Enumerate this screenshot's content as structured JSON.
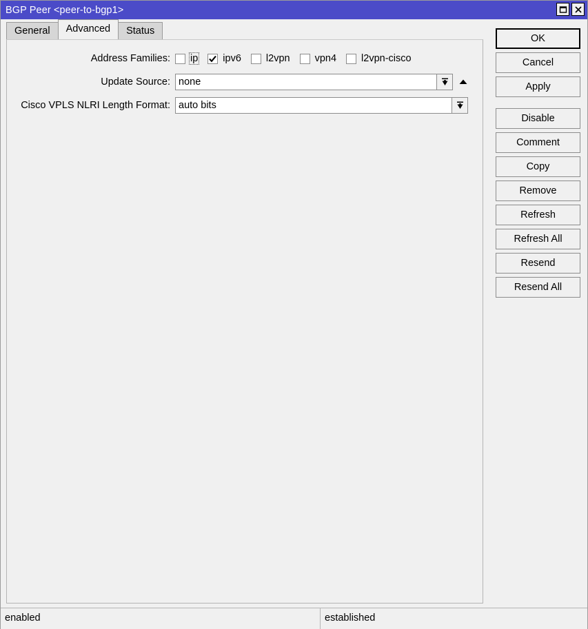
{
  "window": {
    "title": "BGP Peer <peer-to-bgp1>",
    "maximize_icon": "maximize-icon",
    "close_icon": "close-icon"
  },
  "tabs": [
    {
      "label": "General",
      "active": false
    },
    {
      "label": "Advanced",
      "active": true
    },
    {
      "label": "Status",
      "active": false
    }
  ],
  "form": {
    "address_families": {
      "label": "Address Families:",
      "options": [
        {
          "label": "ip",
          "checked": false,
          "focused": true
        },
        {
          "label": "ipv6",
          "checked": true,
          "focused": false
        },
        {
          "label": "l2vpn",
          "checked": false,
          "focused": false
        },
        {
          "label": "vpn4",
          "checked": false,
          "focused": false
        },
        {
          "label": "l2vpn-cisco",
          "checked": false,
          "focused": false
        }
      ]
    },
    "update_source": {
      "label": "Update Source:",
      "value": "none",
      "dropdown_icon": "dropdown-arrow-icon",
      "up_icon": "up-arrow-icon"
    },
    "cisco_vpls_nlri": {
      "label": "Cisco VPLS NLRI Length Format:",
      "value": "auto bits",
      "dropdown_icon": "dropdown-arrow-icon"
    }
  },
  "buttons": [
    {
      "label": "OK",
      "default": true,
      "gap_before": false
    },
    {
      "label": "Cancel",
      "default": false,
      "gap_before": false
    },
    {
      "label": "Apply",
      "default": false,
      "gap_before": false
    },
    {
      "label": "Disable",
      "default": false,
      "gap_before": true
    },
    {
      "label": "Comment",
      "default": false,
      "gap_before": false
    },
    {
      "label": "Copy",
      "default": false,
      "gap_before": false
    },
    {
      "label": "Remove",
      "default": false,
      "gap_before": false
    },
    {
      "label": "Refresh",
      "default": false,
      "gap_before": false
    },
    {
      "label": "Refresh All",
      "default": false,
      "gap_before": false
    },
    {
      "label": "Resend",
      "default": false,
      "gap_before": false
    },
    {
      "label": "Resend All",
      "default": false,
      "gap_before": false
    }
  ],
  "statusbar": {
    "left": "enabled",
    "right": "established"
  },
  "colors": {
    "titlebar": "#4b4bc8",
    "titlebar_text": "#ffffff",
    "window_bg": "#f0f0f0",
    "tab_inactive": "#d6d6d6",
    "border": "#8c8c8c"
  }
}
